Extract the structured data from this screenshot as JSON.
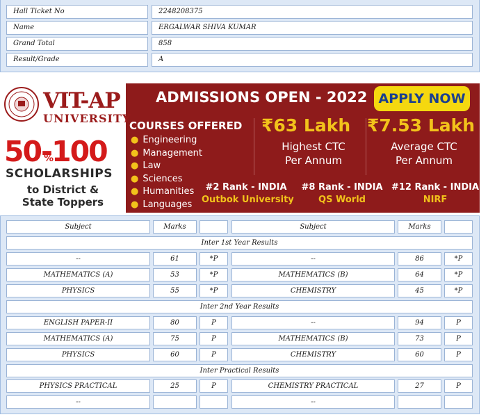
{
  "student": {
    "rows": [
      {
        "label": "Hall Ticket No",
        "value": "2248208375"
      },
      {
        "label": "Name",
        "value": "ERGALWAR SHIVA KUMAR"
      },
      {
        "label": "Grand Total",
        "value": "858"
      },
      {
        "label": "Result/Grade",
        "value": "A"
      }
    ]
  },
  "ad": {
    "logo_title": "VIT-AP",
    "logo_sub": "UNIVERSITY",
    "scholar_pct": "50-100",
    "scholar_pct_symbol": "%",
    "scholar_word": "SCHOLARSHIPS",
    "scholar_line2": "to District &",
    "scholar_line3": "State Toppers",
    "headline": "ADMISSIONS OPEN - 2022",
    "apply_label": "APPLY NOW",
    "courses_title": "COURSES OFFERED",
    "courses": [
      "Engineering",
      "Management",
      "Law",
      "Sciences",
      "Humanities",
      "Languages"
    ],
    "ctc_high_value": "₹63 Lakh",
    "ctc_high_line1": "Highest CTC",
    "ctc_high_line2": "Per Annum",
    "ctc_avg_value": "₹7.53 Lakh",
    "ctc_avg_line1": "Average CTC",
    "ctc_avg_line2": "Per Annum",
    "ranks": [
      {
        "rank": "#2 Rank - INDIA",
        "source": "Outbok University"
      },
      {
        "rank": "#8 Rank - INDIA",
        "source": "QS World"
      },
      {
        "rank": "#12 Rank - INDIA",
        "source": "NIRF"
      }
    ],
    "colors": {
      "maroon": "#8e1b1b",
      "gold": "#f2c21b",
      "apply_bg": "#f5d80f",
      "apply_text": "#1b3f8f"
    }
  },
  "marks": {
    "headers": {
      "subject": "Subject",
      "marks": "Marks"
    },
    "sections": {
      "first": "Inter 1st Year Results",
      "second": "Inter 2nd Year Results",
      "practical": "Inter Practical Results"
    },
    "first_rows": [
      {
        "s1": "--",
        "m1": "61",
        "r1": "*P",
        "s2": "--",
        "m2": "86",
        "r2": "*P"
      },
      {
        "s1": "MATHEMATICS (A)",
        "m1": "53",
        "r1": "*P",
        "s2": "MATHEMATICS (B)",
        "m2": "64",
        "r2": "*P"
      },
      {
        "s1": "PHYSICS",
        "m1": "55",
        "r1": "*P",
        "s2": "CHEMISTRY",
        "m2": "45",
        "r2": "*P"
      }
    ],
    "second_rows": [
      {
        "s1": "ENGLISH PAPER-II",
        "m1": "80",
        "r1": "P",
        "s2": "--",
        "m2": "94",
        "r2": "P"
      },
      {
        "s1": "MATHEMATICS (A)",
        "m1": "75",
        "r1": "P",
        "s2": "MATHEMATICS (B)",
        "m2": "73",
        "r2": "P"
      },
      {
        "s1": "PHYSICS",
        "m1": "60",
        "r1": "P",
        "s2": "CHEMISTRY",
        "m2": "60",
        "r2": "P"
      }
    ],
    "practical_rows": [
      {
        "s1": "PHYSICS PRACTICAL",
        "m1": "25",
        "r1": "P",
        "s2": "CHEMISTRY PRACTICAL",
        "m2": "27",
        "r2": "P"
      },
      {
        "s1": "--",
        "m1": "",
        "r1": "",
        "s2": "--",
        "m2": "",
        "r2": ""
      }
    ]
  }
}
